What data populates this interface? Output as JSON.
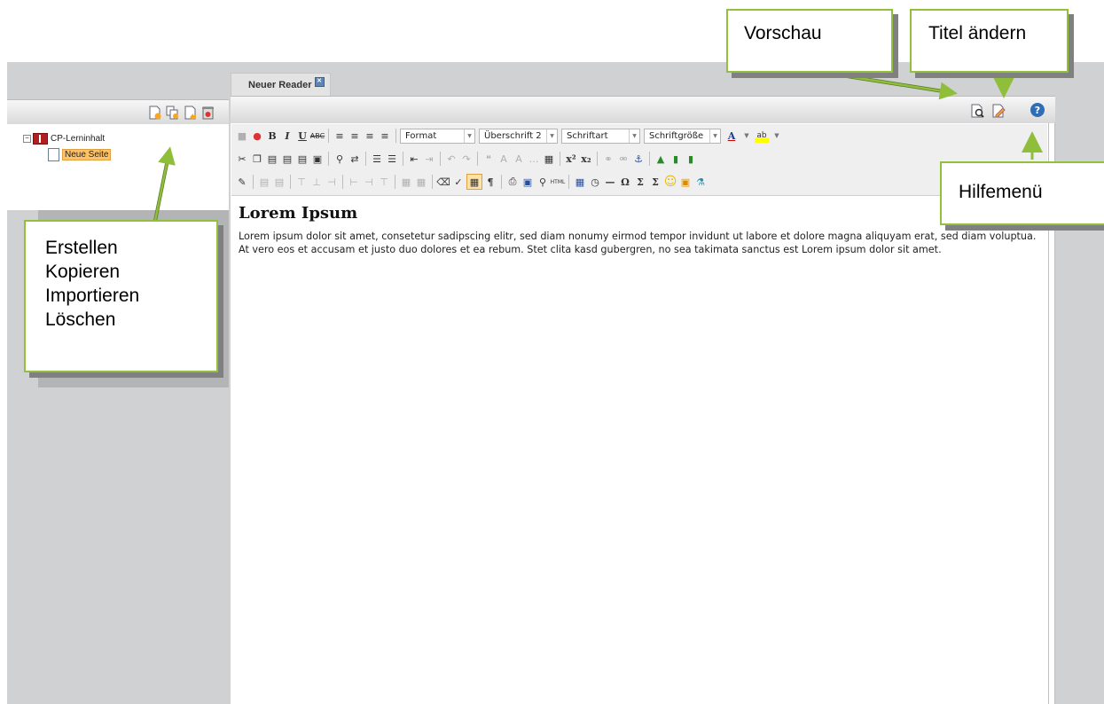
{
  "tab": {
    "label": "Neuer Reader",
    "close": "✕"
  },
  "tree": {
    "root": {
      "label": "CP-Lerninhalt",
      "toggle": "−"
    },
    "child": {
      "label": "Neue Seite"
    }
  },
  "left_toolbar": {
    "create": "create-icon",
    "copy": "copy-icon",
    "import": "import-icon",
    "delete": "delete-icon"
  },
  "header_toolbar": {
    "preview": "preview-icon",
    "edit_title": "edit-title-icon",
    "help": "?"
  },
  "editor_toolbar": {
    "format": "Format",
    "heading": "Überschrift 2",
    "font": "Schriftart",
    "size": "Schriftgröße"
  },
  "content": {
    "title": "Lorem Ipsum",
    "body": "Lorem ipsum dolor sit amet, consetetur sadipscing elitr, sed diam nonumy eirmod tempor invidunt ut labore et dolore magna aliquyam erat, sed diam voluptua. At vero eos et accusam et justo duo dolores et ea rebum. Stet clita kasd gubergren, no sea takimata sanctus est Lorem ipsum dolor sit amet."
  },
  "callouts": {
    "preview": "Vorschau",
    "title": "Titel ändern",
    "help": "Hilfemenü",
    "create_lines": [
      "Erstellen",
      "Kopieren",
      "Importieren",
      "Löschen"
    ]
  },
  "colors": {
    "callout_border": "#92bf3c",
    "arrow": "#8fbf3a",
    "selection": "#ffc266"
  }
}
